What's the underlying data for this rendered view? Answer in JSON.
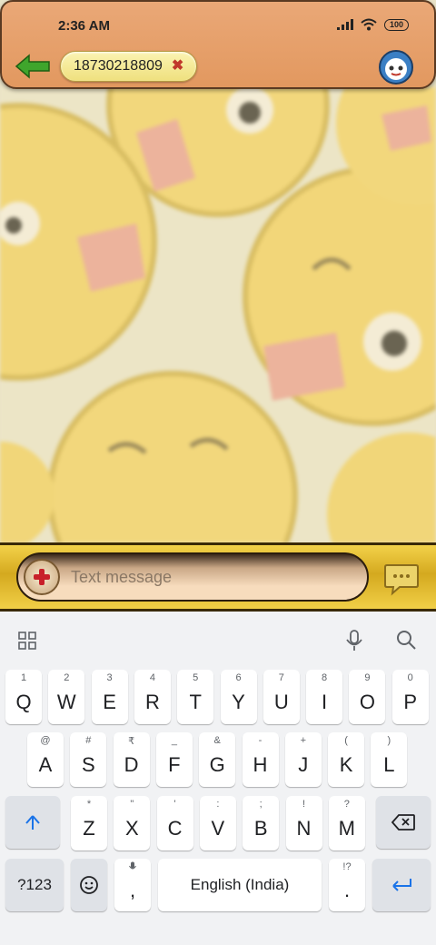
{
  "status_bar": {
    "time": "2:36 AM",
    "battery": "100"
  },
  "header": {
    "contact_number": "18730218809",
    "remove_label": "✖"
  },
  "composer": {
    "placeholder": "Text message"
  },
  "keyboard": {
    "row1": [
      {
        "hint": "1",
        "label": "Q"
      },
      {
        "hint": "2",
        "label": "W"
      },
      {
        "hint": "3",
        "label": "E"
      },
      {
        "hint": "4",
        "label": "R"
      },
      {
        "hint": "5",
        "label": "T"
      },
      {
        "hint": "6",
        "label": "Y"
      },
      {
        "hint": "7",
        "label": "U"
      },
      {
        "hint": "8",
        "label": "I"
      },
      {
        "hint": "9",
        "label": "O"
      },
      {
        "hint": "0",
        "label": "P"
      }
    ],
    "row2": [
      {
        "hint": "@",
        "label": "A"
      },
      {
        "hint": "#",
        "label": "S"
      },
      {
        "hint": "₹",
        "label": "D"
      },
      {
        "hint": "_",
        "label": "F"
      },
      {
        "hint": "&",
        "label": "G"
      },
      {
        "hint": "-",
        "label": "H"
      },
      {
        "hint": "+",
        "label": "J"
      },
      {
        "hint": "(",
        "label": "K"
      },
      {
        "hint": ")",
        "label": "L"
      }
    ],
    "row3": [
      {
        "hint": "*",
        "label": "Z"
      },
      {
        "hint": "\"",
        "label": "X"
      },
      {
        "hint": "'",
        "label": "C"
      },
      {
        "hint": ":",
        "label": "V"
      },
      {
        "hint": ";",
        "label": "B"
      },
      {
        "hint": "!",
        "label": "N"
      },
      {
        "hint": "?",
        "label": "M"
      }
    ],
    "symbols_label": "?123",
    "comma_label": ",",
    "space_label": "English (India)",
    "period_hint": "!?",
    "period_label": ".",
    "accent_color": "#1a73e8"
  }
}
